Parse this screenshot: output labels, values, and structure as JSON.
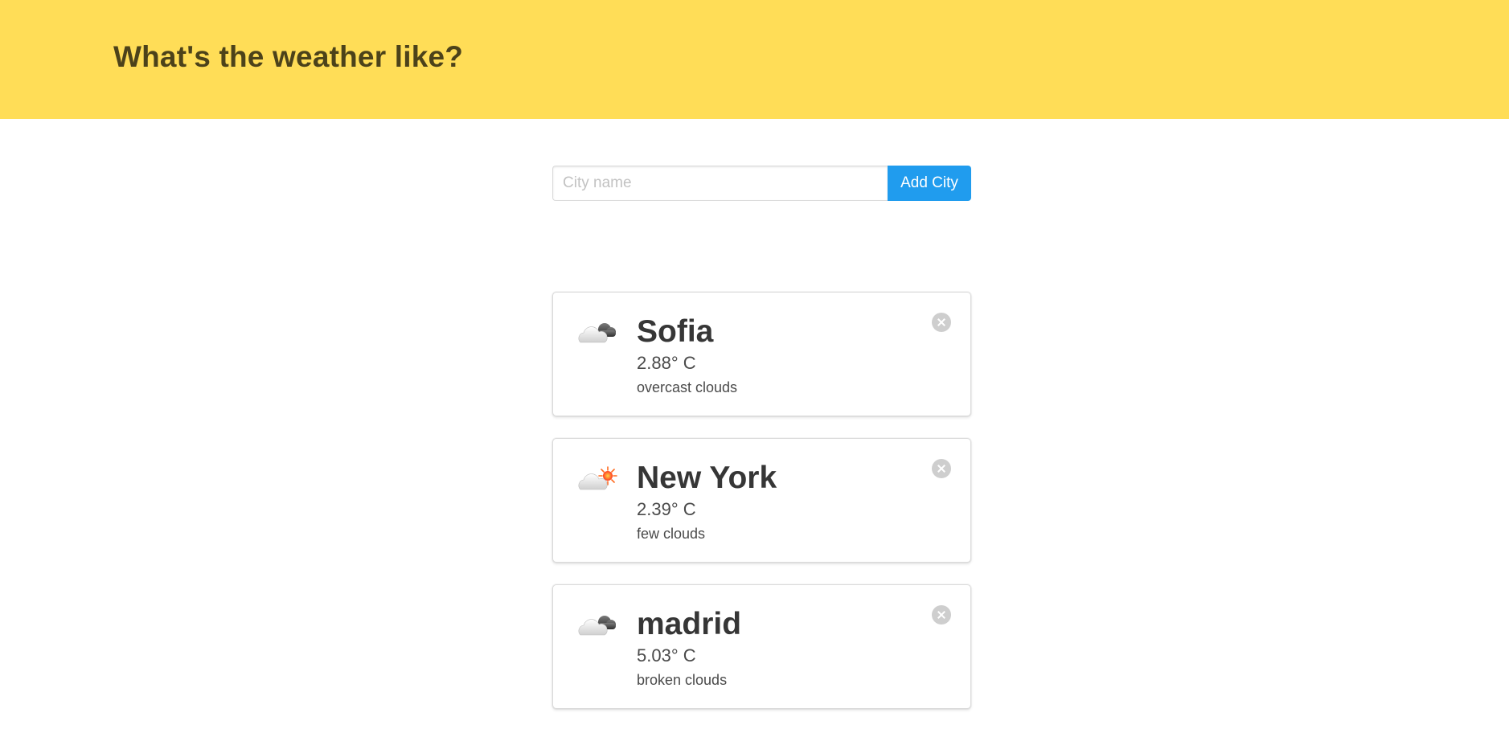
{
  "header": {
    "title": "What's the weather like?"
  },
  "add_form": {
    "placeholder": "City name",
    "value": "",
    "button_label": "Add City"
  },
  "colors": {
    "hero_background": "#ffdd57",
    "button_primary": "#209cee"
  },
  "cities": [
    {
      "name": "Sofia",
      "temperature": "2.88° C",
      "description": "overcast clouds",
      "icon": "overcast-clouds-icon"
    },
    {
      "name": "New York",
      "temperature": "2.39° C",
      "description": "few clouds",
      "icon": "few-clouds-icon"
    },
    {
      "name": "madrid",
      "temperature": "5.03° C",
      "description": "broken clouds",
      "icon": "broken-clouds-icon"
    }
  ]
}
